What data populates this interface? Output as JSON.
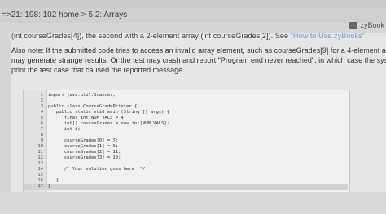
{
  "breadcrumb": "=>21: 198: 102 home > 5.2: Arrays",
  "brand_label": "zyBook",
  "text": {
    "line1_prefix": "(int courseGrades[4]), the second with a 2-element array (int courseGrades[2]). See ",
    "line1_link": "\"How to Use zyBooks\"",
    "line1_suffix": ".",
    "para_lines": [
      "Also note: If the submitted code tries to access an invalid array element, such as courseGrades[9] for a 4-element array, the test",
      "may generate strange results. Or the test may crash and report \"Program end never reached\", in which case the system doesn't",
      "print the test case that caused the reported message."
    ]
  },
  "code": [
    {
      "n": "1",
      "t": "import java.util.Scanner;"
    },
    {
      "n": "2",
      "t": ""
    },
    {
      "n": "3",
      "t": "public class CourseGradePrinter {"
    },
    {
      "n": "4",
      "t": "   public static void main (String [] args) {"
    },
    {
      "n": "5",
      "t": "      final int NUM_VALS = 4;"
    },
    {
      "n": "6",
      "t": "      int[] courseGrades = new int[NUM_VALS];"
    },
    {
      "n": "7",
      "t": "      int i;"
    },
    {
      "n": "8",
      "t": ""
    },
    {
      "n": "9",
      "t": "      courseGrades[0] = 7;"
    },
    {
      "n": "10",
      "t": "      courseGrades[1] = 9;"
    },
    {
      "n": "11",
      "t": "      courseGrades[2] = 11;"
    },
    {
      "n": "12",
      "t": "      courseGrades[3] = 10;"
    },
    {
      "n": "13",
      "t": ""
    },
    {
      "n": "14",
      "t": "      /* Your solution goes here  */"
    },
    {
      "n": "15",
      "t": ""
    },
    {
      "n": "16",
      "t": "   }"
    },
    {
      "n": "17",
      "t": "}"
    }
  ]
}
